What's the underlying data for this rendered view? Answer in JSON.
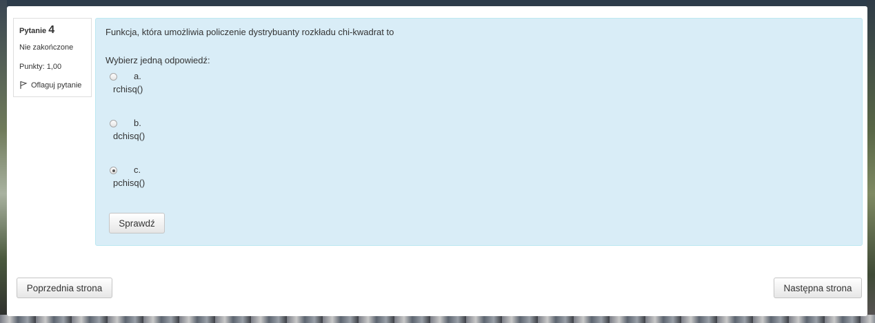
{
  "question_info": {
    "label": "Pytanie",
    "number": "4",
    "state": "Nie zakończone",
    "grade": "Punkty: 1,00",
    "flag_label": "Oflaguj pytanie"
  },
  "question": {
    "text": "Funkcja, która umożliwia policzenie dystrybuanty rozkładu chi-kwadrat to",
    "prompt": "Wybierz jedną odpowiedź:",
    "options": [
      {
        "letter": "a.",
        "text": "rchisq()",
        "checked": false
      },
      {
        "letter": "b.",
        "text": "dchisq()",
        "checked": false
      },
      {
        "letter": "c.",
        "text": "pchisq()",
        "checked": true
      }
    ],
    "check_label": "Sprawdź"
  },
  "navigation": {
    "prev_label": "Poprzednia strona",
    "next_label": "Następna strona"
  }
}
